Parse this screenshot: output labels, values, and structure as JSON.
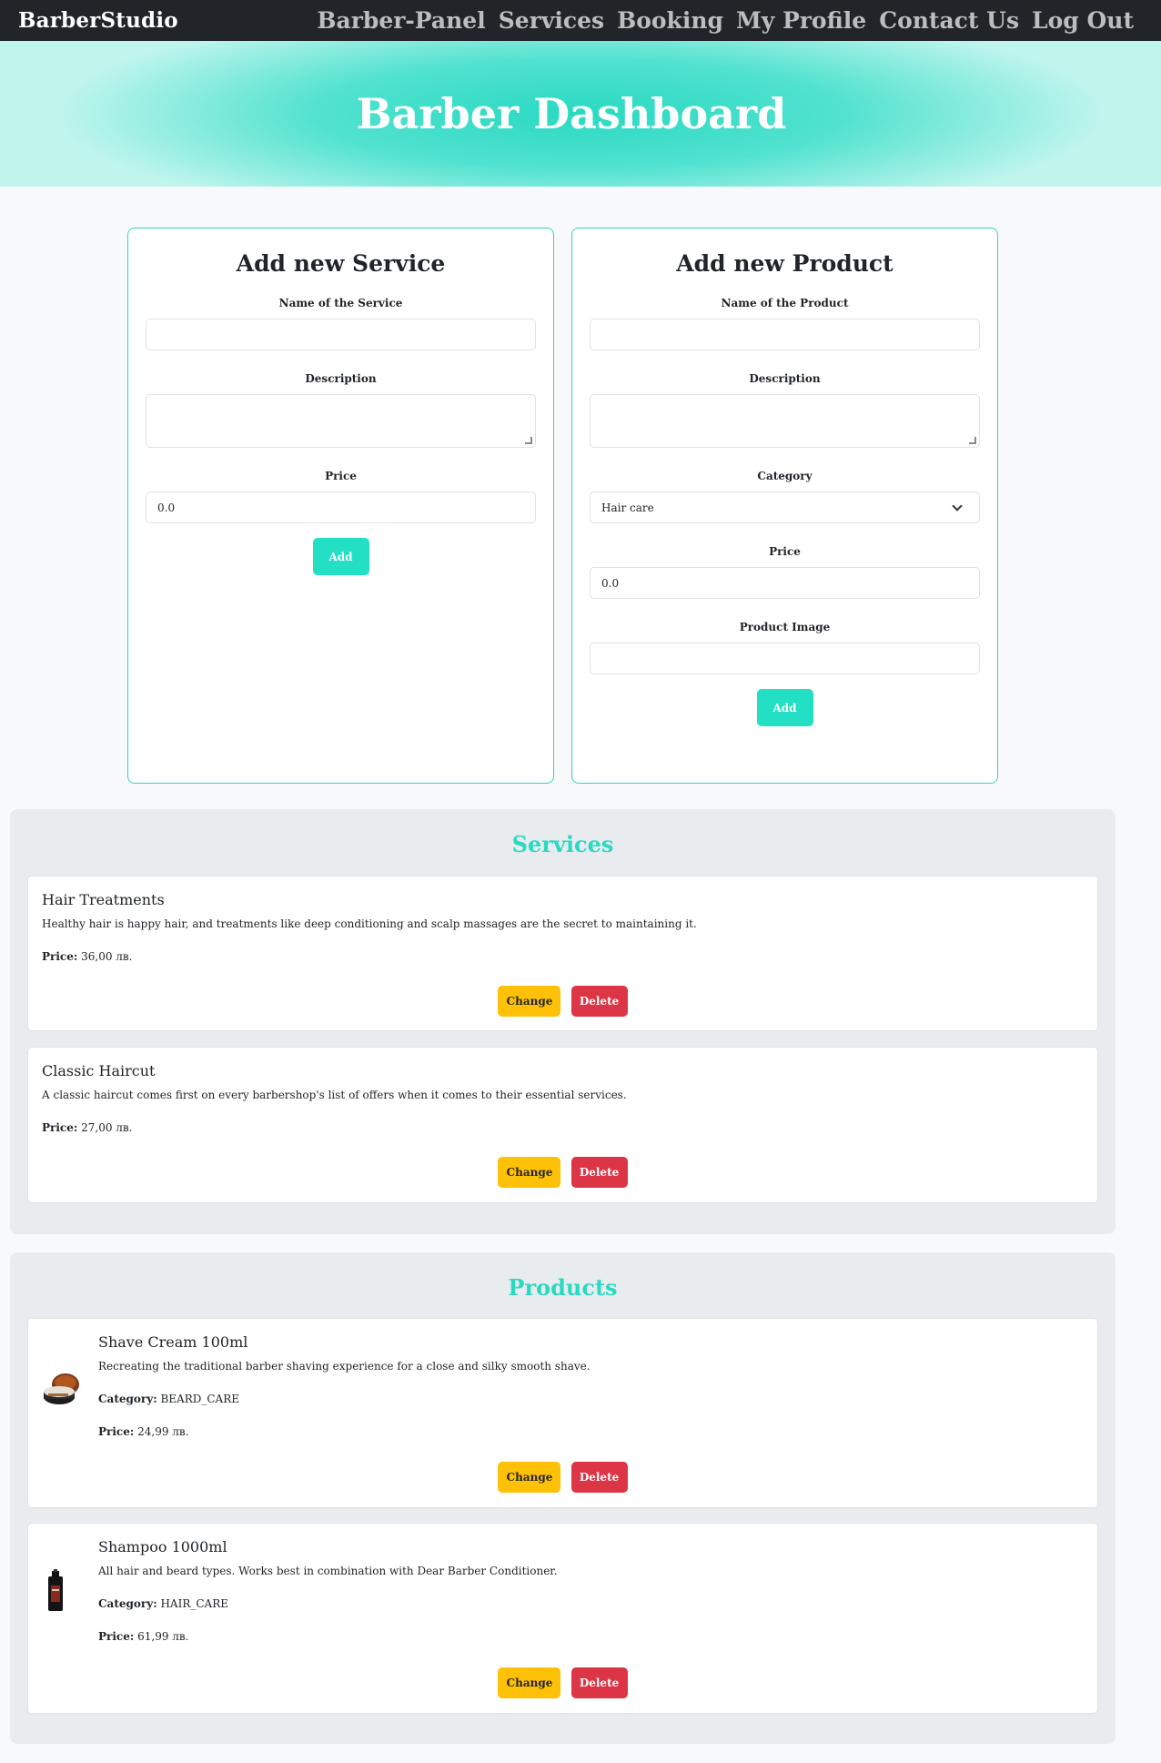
{
  "navbar": {
    "brand": "BarberStudio",
    "links": [
      "Barber-Panel",
      "Services",
      "Booking",
      "My Profile",
      "Contact Us",
      "Log Out"
    ]
  },
  "hero": {
    "title": "Barber Dashboard"
  },
  "service_form": {
    "title": "Add new Service",
    "name_label": "Name of the Service",
    "name_value": "",
    "description_label": "Description",
    "description_value": "",
    "price_label": "Price",
    "price_value": "0.0",
    "submit_label": "Add"
  },
  "product_form": {
    "title": "Add new Product",
    "name_label": "Name of the Product",
    "name_value": "",
    "description_label": "Description",
    "description_value": "",
    "category_label": "Category",
    "category_value": "Hair care",
    "price_label": "Price",
    "price_value": "0.0",
    "image_label": "Product Image",
    "image_value": "",
    "submit_label": "Add"
  },
  "services_section": {
    "title": "Services",
    "price_label": "Price:",
    "change_label": "Change",
    "delete_label": "Delete",
    "items": [
      {
        "name": "Hair Treatments",
        "description": "Healthy hair is happy hair, and treatments like deep conditioning and scalp massages are the secret to maintaining it.",
        "price": "36,00 лв."
      },
      {
        "name": "Classic Haircut",
        "description": "A classic haircut comes first on every barbershop's list of offers when it comes to their essential services.",
        "price": "27,00 лв."
      }
    ]
  },
  "products_section": {
    "title": "Products",
    "category_label": "Category:",
    "price_label": "Price:",
    "change_label": "Change",
    "delete_label": "Delete",
    "items": [
      {
        "name": "Shave Cream 100ml",
        "description": "Recreating the traditional barber shaving experience for a close and silky smooth shave.",
        "category": "BEARD_CARE",
        "price": "24,99 лв."
      },
      {
        "name": "Shampoo 1000ml",
        "description": "All hair and beard types. Works best in combination with Dear Barber Conditioner.",
        "category": "HAIR_CARE",
        "price": "61,99 лв."
      }
    ]
  },
  "colors": {
    "accent": "#2ad9c1",
    "navbar_bg": "#212529",
    "warning": "#ffc107",
    "danger": "#dc3545"
  }
}
